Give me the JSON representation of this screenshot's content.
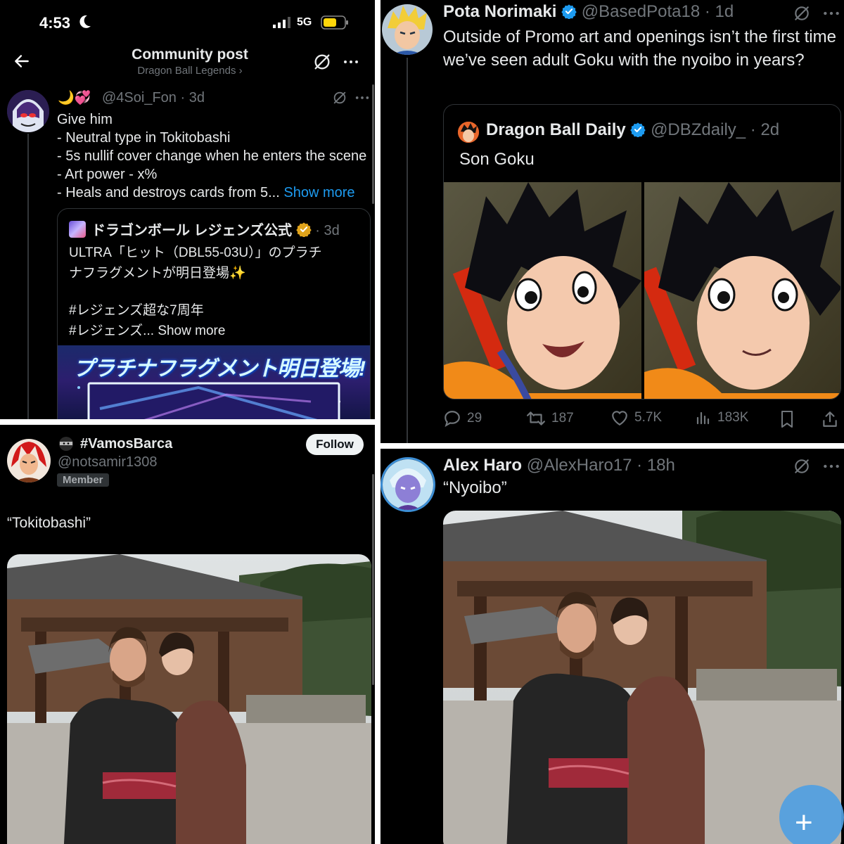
{
  "colors": {
    "accent": "#1d9bf0",
    "muted": "#71767b",
    "verified_gold": "#e0a31b"
  },
  "panel1": {
    "status_time": "4:53",
    "network": "5G",
    "title": "Community post",
    "subtitle": "Dragon Ball Legends ›",
    "reply": {
      "handle": "@4Soi_Fon · 3d",
      "emoji": "🌙💞",
      "lines": [
        "Give him",
        "- Neutral type in Tokitobashi",
        "- 5s nullif cover change when he enters the scene",
        "- Art power - x%",
        "- Heals and destroys cards from 5..."
      ],
      "show_more": "Show more"
    },
    "quote": {
      "name": "ドラゴンボール レジェンズ公式",
      "time": "· 3d",
      "line1": "ULTRA「ヒット（DBL55-03U）」のプラチ",
      "line2": "ナフラグメントが明日登場✨",
      "line3": "#レジェンズ超な7周年",
      "line4": "#レジェンズ...",
      "show_more": "Show more",
      "banner_text": "プラチナフラグメント明日登場!"
    }
  },
  "panel2": {
    "name": "#VamosBarca",
    "handle": "@notsamir1308",
    "badge": "Member",
    "follow": "Follow",
    "text": "“Tokitobashi”"
  },
  "panel3": {
    "name": "Pota Norimaki",
    "handle": "@BasedPota18 · 1d",
    "text": "Outside of Promo art and openings isn’t the first time we’ve seen adult Goku with the nyoibo in years?",
    "quote": {
      "name": "Dragon Ball Daily",
      "handle": "@DBZdaily_ · 2d",
      "text": "Son Goku"
    },
    "stats": {
      "replies": "29",
      "reposts": "187",
      "likes": "5.7K",
      "views": "183K"
    }
  },
  "panel4": {
    "name": "Alex Haro",
    "handle": "@AlexHaro17 · 18h",
    "text": "“Nyoibo”",
    "fab": "+"
  }
}
